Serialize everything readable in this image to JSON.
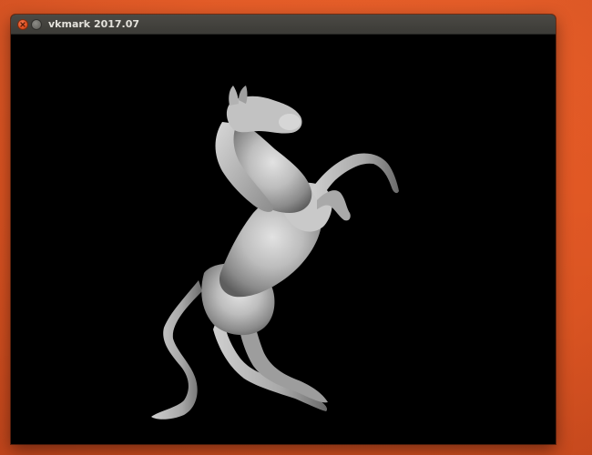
{
  "window": {
    "title": "vkmark 2017.07",
    "controls": {
      "close_icon": "close-icon",
      "minimize_icon": "minimize-icon"
    }
  },
  "scene": {
    "subject": "rearing-horse-model",
    "background_color": "#000000",
    "model_color": "#bdbdbd"
  },
  "desktop": {
    "background_color": "#df5623"
  }
}
